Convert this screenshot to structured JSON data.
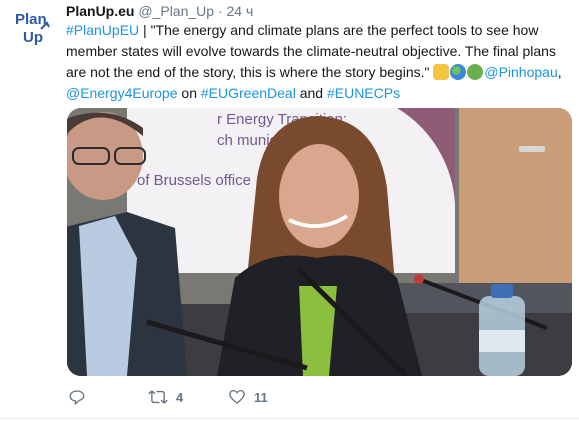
{
  "avatar": {
    "line1": "Plan",
    "line2": "Up"
  },
  "header": {
    "name": "PlanUp.eu",
    "handle": "@_Plan_Up",
    "separator": "·",
    "time": "24 ч"
  },
  "tweet": {
    "hashtag_planupeu": "#PlanUpEU",
    "pipe": " | ",
    "quote": "\"The energy and climate plans are the perfect tools to see how member states will evolve towards the climate-neutral objective. The final plans are not the end of the story, this is where the story begins.\"",
    "emojis": [
      "flexed-biceps",
      "globe",
      "green-heart"
    ],
    "mention_pinhopau": "@Pinhopau",
    "comma": ",",
    "mention_energy4europe": "@Energy4Europe",
    "on": " on ",
    "hashtag_greendeal": "#EUGreenDeal",
    "and": " and ",
    "hashtag_necps": "#EUNECPs"
  },
  "media": {
    "slide_lines": [
      "r Energy Transition:",
      "ch municipalities",
      "of Brussels office"
    ]
  },
  "actions": {
    "reply_count": "",
    "retweet_count": "4",
    "like_count": "11"
  },
  "colors": {
    "link": "#1b95e0",
    "muted": "#657786",
    "brand": "#2c5aa0"
  }
}
